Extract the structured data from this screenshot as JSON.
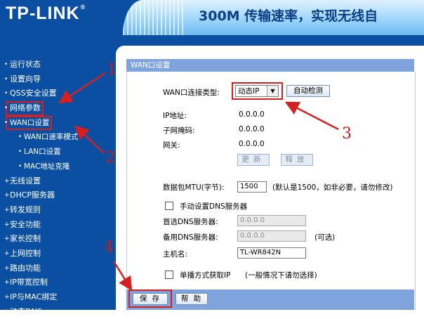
{
  "header": {
    "logo": "TP-LINK",
    "logo_mark": "®",
    "slogan": "300M 传输速率，实现无线自"
  },
  "menu": [
    {
      "label": "运行状态",
      "sub": false
    },
    {
      "label": "设置向导",
      "sub": false
    },
    {
      "label": "QSS安全设置",
      "sub": false
    },
    {
      "label": "网络参数",
      "sub": false,
      "highlight": true
    },
    {
      "label": "WAN口设置",
      "sub": true,
      "highlight": true
    },
    {
      "label": "WAN口速率模式",
      "sub": true
    },
    {
      "label": "LAN口设置",
      "sub": true
    },
    {
      "label": "MAC地址克隆",
      "sub": true
    },
    {
      "label": "无线设置",
      "sub": false
    },
    {
      "label": "DHCP服务器",
      "sub": false
    },
    {
      "label": "转发规则",
      "sub": false
    },
    {
      "label": "安全功能",
      "sub": false
    },
    {
      "label": "家长控制",
      "sub": false
    },
    {
      "label": "上网控制",
      "sub": false
    },
    {
      "label": "路由功能",
      "sub": false
    },
    {
      "label": "IP带宽控制",
      "sub": false
    },
    {
      "label": "IP与MAC绑定",
      "sub": false
    },
    {
      "label": "动态DNS",
      "sub": false
    }
  ],
  "panel": {
    "title": "WAN口设置",
    "wan_type_label": "WAN口连接类型:",
    "wan_type_value": "动态IP",
    "auto_detect": "自动检测",
    "ip_label": "IP地址:",
    "ip_value": "0.0.0.0",
    "mask_label": "子网掩码:",
    "mask_value": "0.0.0.0",
    "gateway_label": "网关:",
    "gateway_value": "0.0.0.0",
    "renew": "更新",
    "release": "释放",
    "mtu_label": "数据包MTU(字节):",
    "mtu_value": "1500",
    "mtu_hint": "(默认是1500，如非必要，请勿修改)",
    "manual_dns": "手动设置DNS服务器",
    "dns1_label": "首选DNS服务器:",
    "dns1_value": "0.0.0.0",
    "dns2_label": "备用DNS服务器:",
    "dns2_value": "0.0.0.0",
    "dns2_hint": "(可选)",
    "hostname_label": "主机名:",
    "hostname_value": "TL-WR842N",
    "unicast_label": "单播方式获取IP",
    "unicast_hint": "(一般情况下请勿选择)",
    "save": "保 存",
    "help": "帮 助"
  },
  "annotations": [
    "1",
    "2",
    "3",
    "4"
  ],
  "colors": {
    "nav_blue": "#0b4fa3",
    "title_bar": "#7fa3dd",
    "annotation_red": "#d42020"
  }
}
